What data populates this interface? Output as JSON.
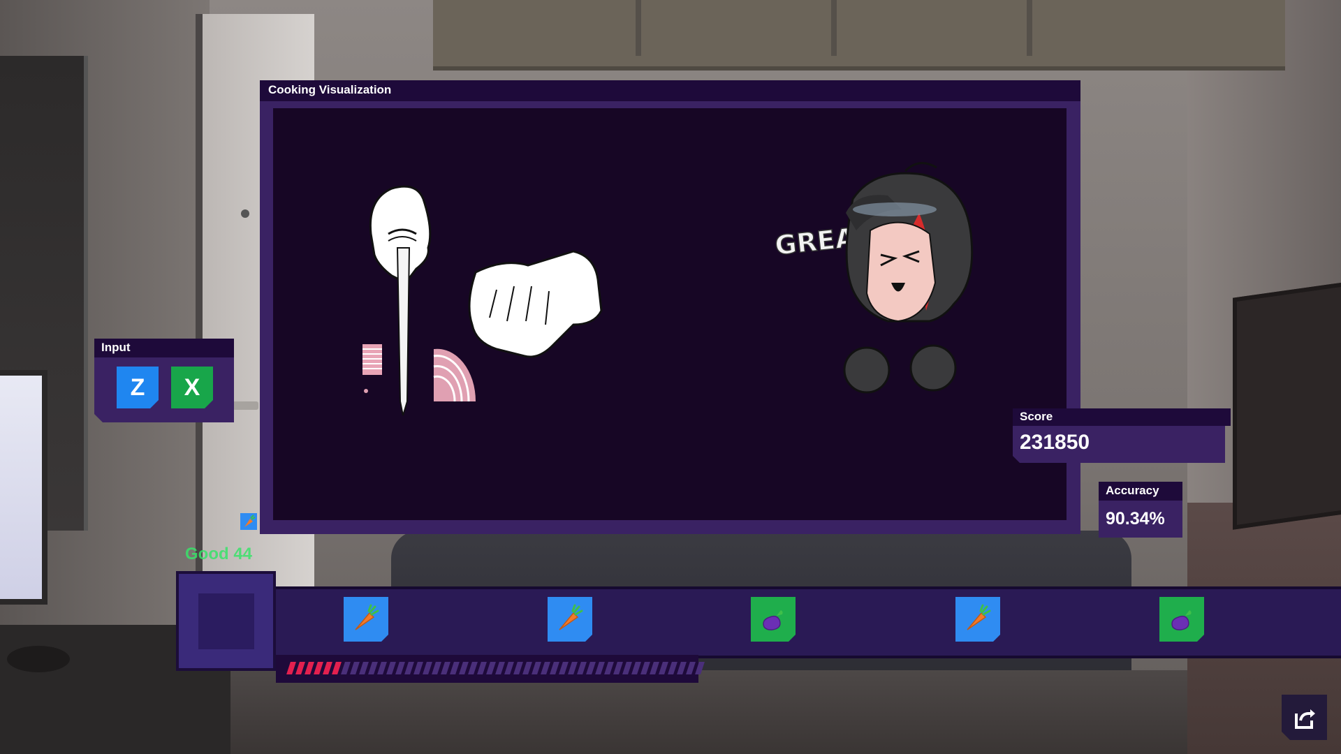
{
  "panels": {
    "cooking_visualization": {
      "title": "Cooking Visualization"
    },
    "input": {
      "title": "Input",
      "keys": [
        "Z",
        "X"
      ]
    },
    "score": {
      "label": "Score",
      "value": "231850"
    },
    "accuracy": {
      "label": "Accuracy",
      "value": "90.34%"
    }
  },
  "stage": {
    "judgement_text": "GREAT"
  },
  "track": {
    "judgement": "Good 44",
    "notes": [
      "carrot",
      "carrot",
      "eggplant",
      "carrot",
      "eggplant"
    ],
    "progress_fraction": 0.13
  },
  "colors": {
    "panel_header": "#1e0a3a",
    "panel_body": "#3a2263",
    "stage_bg": "#170625",
    "key_z": "#1f86f0",
    "key_x": "#18a64a",
    "good_text": "#39e36a",
    "progress_filled": "#e3204f"
  },
  "icons": {
    "exit": "exit-arrow-icon",
    "carrot": "carrot-icon",
    "eggplant": "eggplant-icon"
  }
}
